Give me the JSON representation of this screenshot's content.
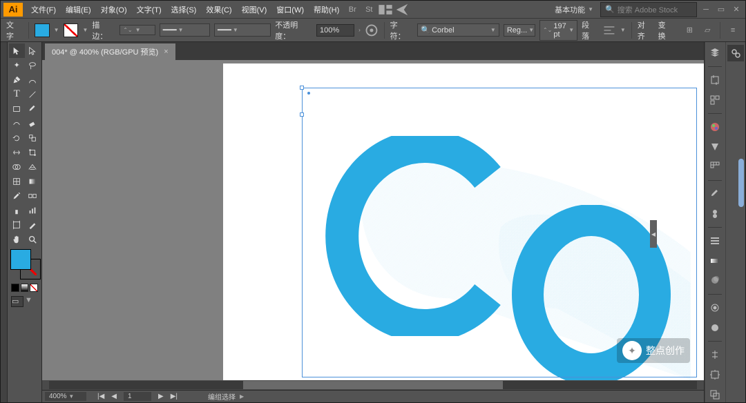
{
  "app": {
    "logo": "Ai"
  },
  "menu": {
    "items": [
      "文件(F)",
      "编辑(E)",
      "对象(O)",
      "文字(T)",
      "选择(S)",
      "效果(C)",
      "视图(V)",
      "窗口(W)",
      "帮助(H)"
    ]
  },
  "menu_right": {
    "workspace": "基本功能",
    "search_placeholder": "搜索 Adobe Stock"
  },
  "control": {
    "left_label": "文字",
    "stroke_label": "描边：",
    "stroke_weight": "",
    "stroke_panel": "",
    "opacity_label": "不透明度：",
    "opacity_value": "100%",
    "char_label": "字符：",
    "font_name": "Corbel",
    "font_style": "Reg...",
    "font_size": "197 pt",
    "para_label": "段落",
    "align_label": "对齐",
    "transform_label": "变换"
  },
  "doc": {
    "tab": "004* @ 400% (RGB/GPU 预览)"
  },
  "status": {
    "zoom": "400%",
    "page": "1",
    "mode": "编组选择"
  },
  "watermark": {
    "text": "整点创作"
  },
  "colors": {
    "accent": "#29abe2"
  }
}
